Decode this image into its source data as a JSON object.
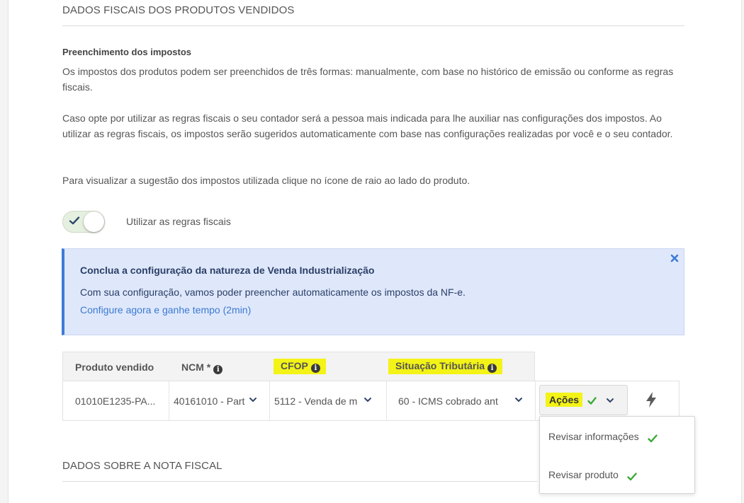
{
  "sections": {
    "fiscal_title": "DADOS FISCAIS DOS PRODUTOS VENDIDOS",
    "nota_title": "DADOS SOBRE A NOTA FISCAL"
  },
  "taxes": {
    "heading": "Preenchimento dos impostos",
    "p1": "Os impostos dos produtos podem ser preenchidos de três formas: manualmente, com base no histórico de emissão ou conforme as regras fiscais.",
    "p2": "Caso opte por utilizar as regras fiscais o seu contador será a pessoa mais indicada para lhe auxiliar nas configurações dos impostos. Ao utilizar as regras fiscais, os impostos serão sugeridos automaticamente com base nas configurações realizadas por você e o seu contador.",
    "p3": "Para visualizar a sugestão dos impostos utilizada clique no ícone de raio ao lado do produto."
  },
  "toggle": {
    "label": "Utilizar as regras fiscais",
    "checked": true
  },
  "alert": {
    "title": "Conclua a configuração da natureza de Venda Industrialização",
    "text": "Com sua configuração, vamos poder preencher automaticamente os impostos da NF-e.",
    "link": "Configure agora e ganhe tempo (2min)"
  },
  "table": {
    "headers": {
      "product": "Produto vendido",
      "ncm": "NCM *",
      "cfop": "CFOP",
      "situacao": "Situação Tributária"
    },
    "row": {
      "product": "01010E1235-PA...",
      "ncm": "40161010 - Part",
      "cfop": "5112 - Venda de m",
      "situacao": "60 - ICMS cobrado ant"
    }
  },
  "actions": {
    "label": "Ações",
    "menu": [
      "Revisar informações",
      "Revisar produto"
    ]
  },
  "colors": {
    "highlight": "#f3f317",
    "alert_bg": "#dfe8fb",
    "alert_border": "#3d7bd6",
    "link": "#3b79d2",
    "check_green": "#3aaa35"
  },
  "icons": [
    "check-icon",
    "close-icon",
    "info-icon",
    "chevron-down-icon",
    "lightning-icon"
  ]
}
